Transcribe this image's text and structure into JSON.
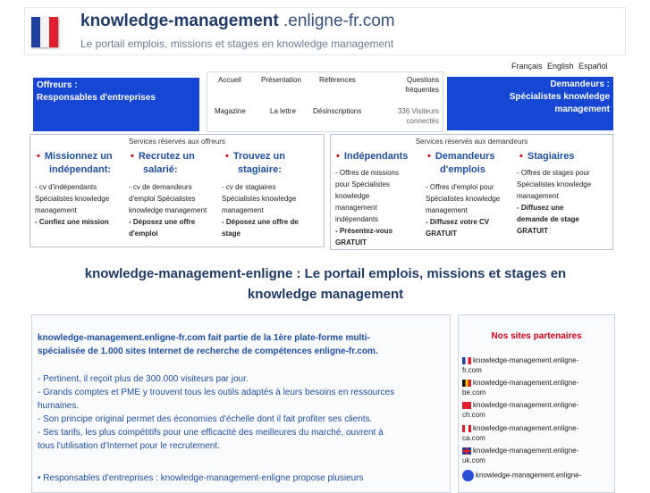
{
  "header": {
    "site_name": "knowledge-management",
    "site_domain": " .enligne-fr.com",
    "tagline": "Le portail emplois, missions et stages en knowledge management",
    "flag": "france-flag-icon"
  },
  "languages": [
    "Français",
    "English",
    "Español"
  ],
  "offreurs_box": {
    "line1": "Offreurs :",
    "line2": "Responsables d'entreprises"
  },
  "demandeurs_box": {
    "line1": "Demandeurs :",
    "line2": "Spécialistes knowledge",
    "line3": "management"
  },
  "nav": {
    "accueil": "Accueil",
    "presentation": "Présentation",
    "references": "Références",
    "questions1": "Questions",
    "questions2": "fréquentes",
    "magazine": "Magazine",
    "lettre": "La lettre",
    "desinscriptions": "Désinscriptions",
    "visiteurs1": "336 Visiteurs",
    "visiteurs2": "connectés"
  },
  "services_offreurs": {
    "title": "Services réservés aux offreurs",
    "col1": {
      "head1": "Missionnez un",
      "head2": "indépendant:",
      "t1": "- cv d'indépendants",
      "t2": "Spécialistes knowledge",
      "t3": "management",
      "t4": "- Confiez une mission"
    },
    "col2": {
      "head1": "Recrutez un",
      "head2": "salarié:",
      "t1": "- cv de demandeurs",
      "t2": "d'emploi Spécialistes",
      "t3": "knowledge management",
      "t4": "- Déposez une offre",
      "t5": "d'emploi"
    },
    "col3": {
      "head1": "Trouvez un",
      "head2": "stagiaire:",
      "t1": "- cv de stagiaires",
      "t2": "Spécialistes knowledge",
      "t3": "management",
      "t4": "- Déposez une offre de",
      "t5": "stage"
    }
  },
  "services_demandeurs": {
    "title": "Services réservés aux demandeurs",
    "col1": {
      "head1": "Indépendants",
      "t1": "- Offres de missions",
      "t2": "pour Spécialistes",
      "t3": "knowledge",
      "t4": "management",
      "t5": "indépendants",
      "t6": "- Présentez-vous",
      "t7": "GRATUIT"
    },
    "col2": {
      "head1": "Demandeurs",
      "head2": "d'emplois",
      "t1": "- Offres d'emploi pour",
      "t2": "Spécialistes knowledge",
      "t3": "management",
      "t4": "- Diffusez votre CV",
      "t5": "GRATUIT"
    },
    "col3": {
      "head1": "Stagiaires",
      "t1": "- Offres de stages pour",
      "t2": "Spécialistes knowledge",
      "t3": "management",
      "t4": "- Diffusez une",
      "t5": "demande de stage",
      "t6": "GRATUIT"
    }
  },
  "main_title": {
    "line1": "knowledge-management-enligne : Le portail emplois, missions et stages en",
    "line2": "knowledge management"
  },
  "content": {
    "intro1": "knowledge-management.enligne-fr.com fait partie de la 1ère plate-forme multi-",
    "intro2": "spécialisée de 1.000 sites Internet de recherche de compétences enligne-fr.com.",
    "p1": "- Pertinent, il reçoit plus de 300.000 visiteurs par jour.",
    "p2a": "- Grands comptes et PME y trouvent tous les outils adaptés à leurs besoins en ressources",
    "p2b": "humaines.",
    "p3": "- Son principe original permet des économies d'échelle dont il fait profiter ses clients.",
    "p4a": "- Ses tarifs, les plus compétitifs pour une efficacité des meilleures du marché, ouvrent à",
    "p4b": "tous l'utilisation d'Internet pour le recrutement.",
    "p5": "• Responsables d'entreprises :  knowledge-management-enligne propose plusieurs"
  },
  "partners": {
    "title": "Nos sites partenaires",
    "items": [
      {
        "l1": "knowledge-management.enligne-",
        "l2": "fr.com",
        "flag": "france-flag-icon"
      },
      {
        "l1": "knowledge-management.enligne-",
        "l2": "be.com",
        "flag": "belgium-flag-icon"
      },
      {
        "l1": "knowledge-management.enligne-",
        "l2": "ch.com",
        "flag": "switzerland-flag-icon"
      },
      {
        "l1": "knowledge-management.enligne-",
        "l2": "ca.com",
        "flag": "canada-flag-icon"
      },
      {
        "l1": "knowledge-management.enligne-",
        "l2": "uk.com",
        "flag": "uk-flag-icon"
      },
      {
        "l1": "knowledge-management.enligne-",
        "l2": "",
        "flag": "globe-icon"
      }
    ]
  }
}
